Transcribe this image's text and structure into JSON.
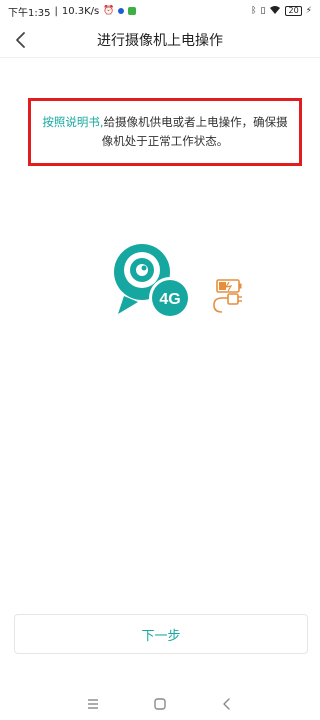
{
  "status_bar": {
    "time": "下午1:35",
    "network_speed": "10.3K/s",
    "battery_level": "20",
    "icons": [
      "alarm-icon",
      "dot-icon",
      "app-icon",
      "bluetooth-icon",
      "vibrate-icon",
      "wifi-icon",
      "battery-icon",
      "charging-icon"
    ]
  },
  "header": {
    "title": "进行摄像机上电操作",
    "back_icon": "chevron-left-icon"
  },
  "instruction": {
    "link_text": "按照说明书,",
    "text": "给摄像机供电或者上电操作，确保摄像机处于正常工作状态。"
  },
  "illustration": {
    "badge_text": "4G",
    "icon": "camera-4g-icon"
  },
  "footer": {
    "next_label": "下一步"
  },
  "nav_bar": {
    "icons": [
      "menu-icon",
      "home-icon",
      "back-icon"
    ]
  },
  "colors": {
    "accent": "#16a8a0",
    "highlight_border": "#e11d1d",
    "battery_accent": "#e58f3c"
  }
}
